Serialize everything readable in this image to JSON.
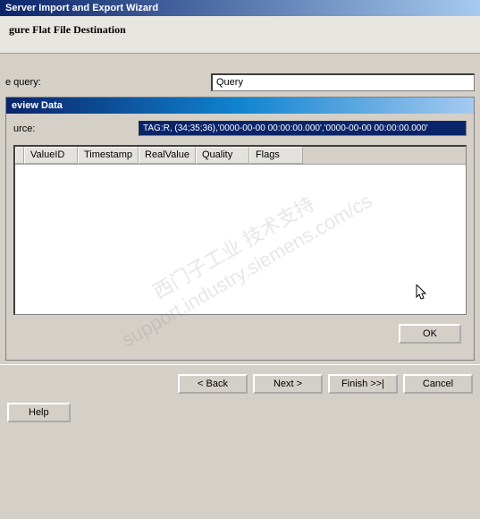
{
  "outer_title": "Server Import and Export Wizard",
  "wizard_heading": "gure Flat File Destination",
  "query_label": "e query:",
  "query_value": "Query",
  "dialog": {
    "title": "eview Data",
    "source_label": "urce:",
    "source_value": "TAG:R, (34;35;36),'0000-00-00 00:00:00.000','0000-00-00 00:00:00.000'",
    "columns": [
      "",
      "ValueID",
      "Timestamp",
      "RealValue",
      "Quality",
      "Flags"
    ],
    "ok_label": "OK"
  },
  "nav": {
    "help": "Help",
    "back": "< Back",
    "next": "Next >",
    "finish": "Finish >>|",
    "cancel": "Cancel"
  },
  "watermark_line1": "西门子工业 技术支持",
  "watermark_line2": "support.industry.siemens.com/cs"
}
